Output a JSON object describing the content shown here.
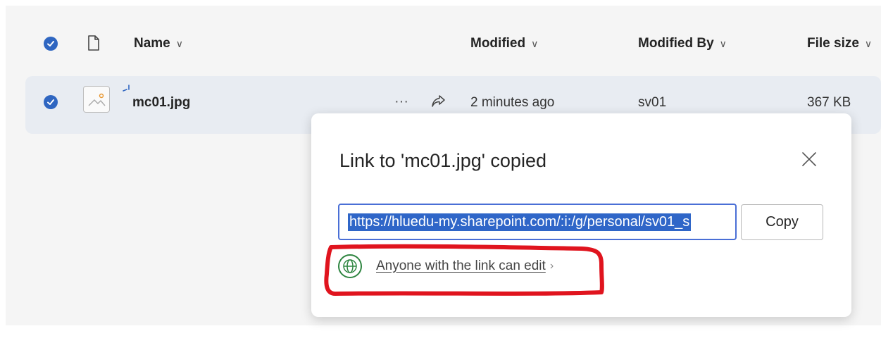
{
  "header": {
    "name_label": "Name",
    "modified_label": "Modified",
    "modified_by_label": "Modified By",
    "file_size_label": "File size",
    "chevron": "∨"
  },
  "file_row": {
    "name": "mc01.jpg",
    "more_label": "···",
    "modified": "2 minutes ago",
    "modified_by": "sv01",
    "file_size": "367 KB"
  },
  "dialog": {
    "title": "Link to 'mc01.jpg' copied",
    "link_value": "https://hluedu-my.sharepoint.com/:i:/g/personal/sv01_s",
    "copy_label": "Copy",
    "permission_label": "Anyone with the link can edit",
    "permission_chevron": "›"
  },
  "colors": {
    "accent": "#2f66c1",
    "globe": "#2e8540",
    "annotation": "#e0141e"
  },
  "icons": [
    "check-icon",
    "file-icon",
    "image-file-icon",
    "share-icon",
    "close-icon",
    "globe-icon"
  ]
}
